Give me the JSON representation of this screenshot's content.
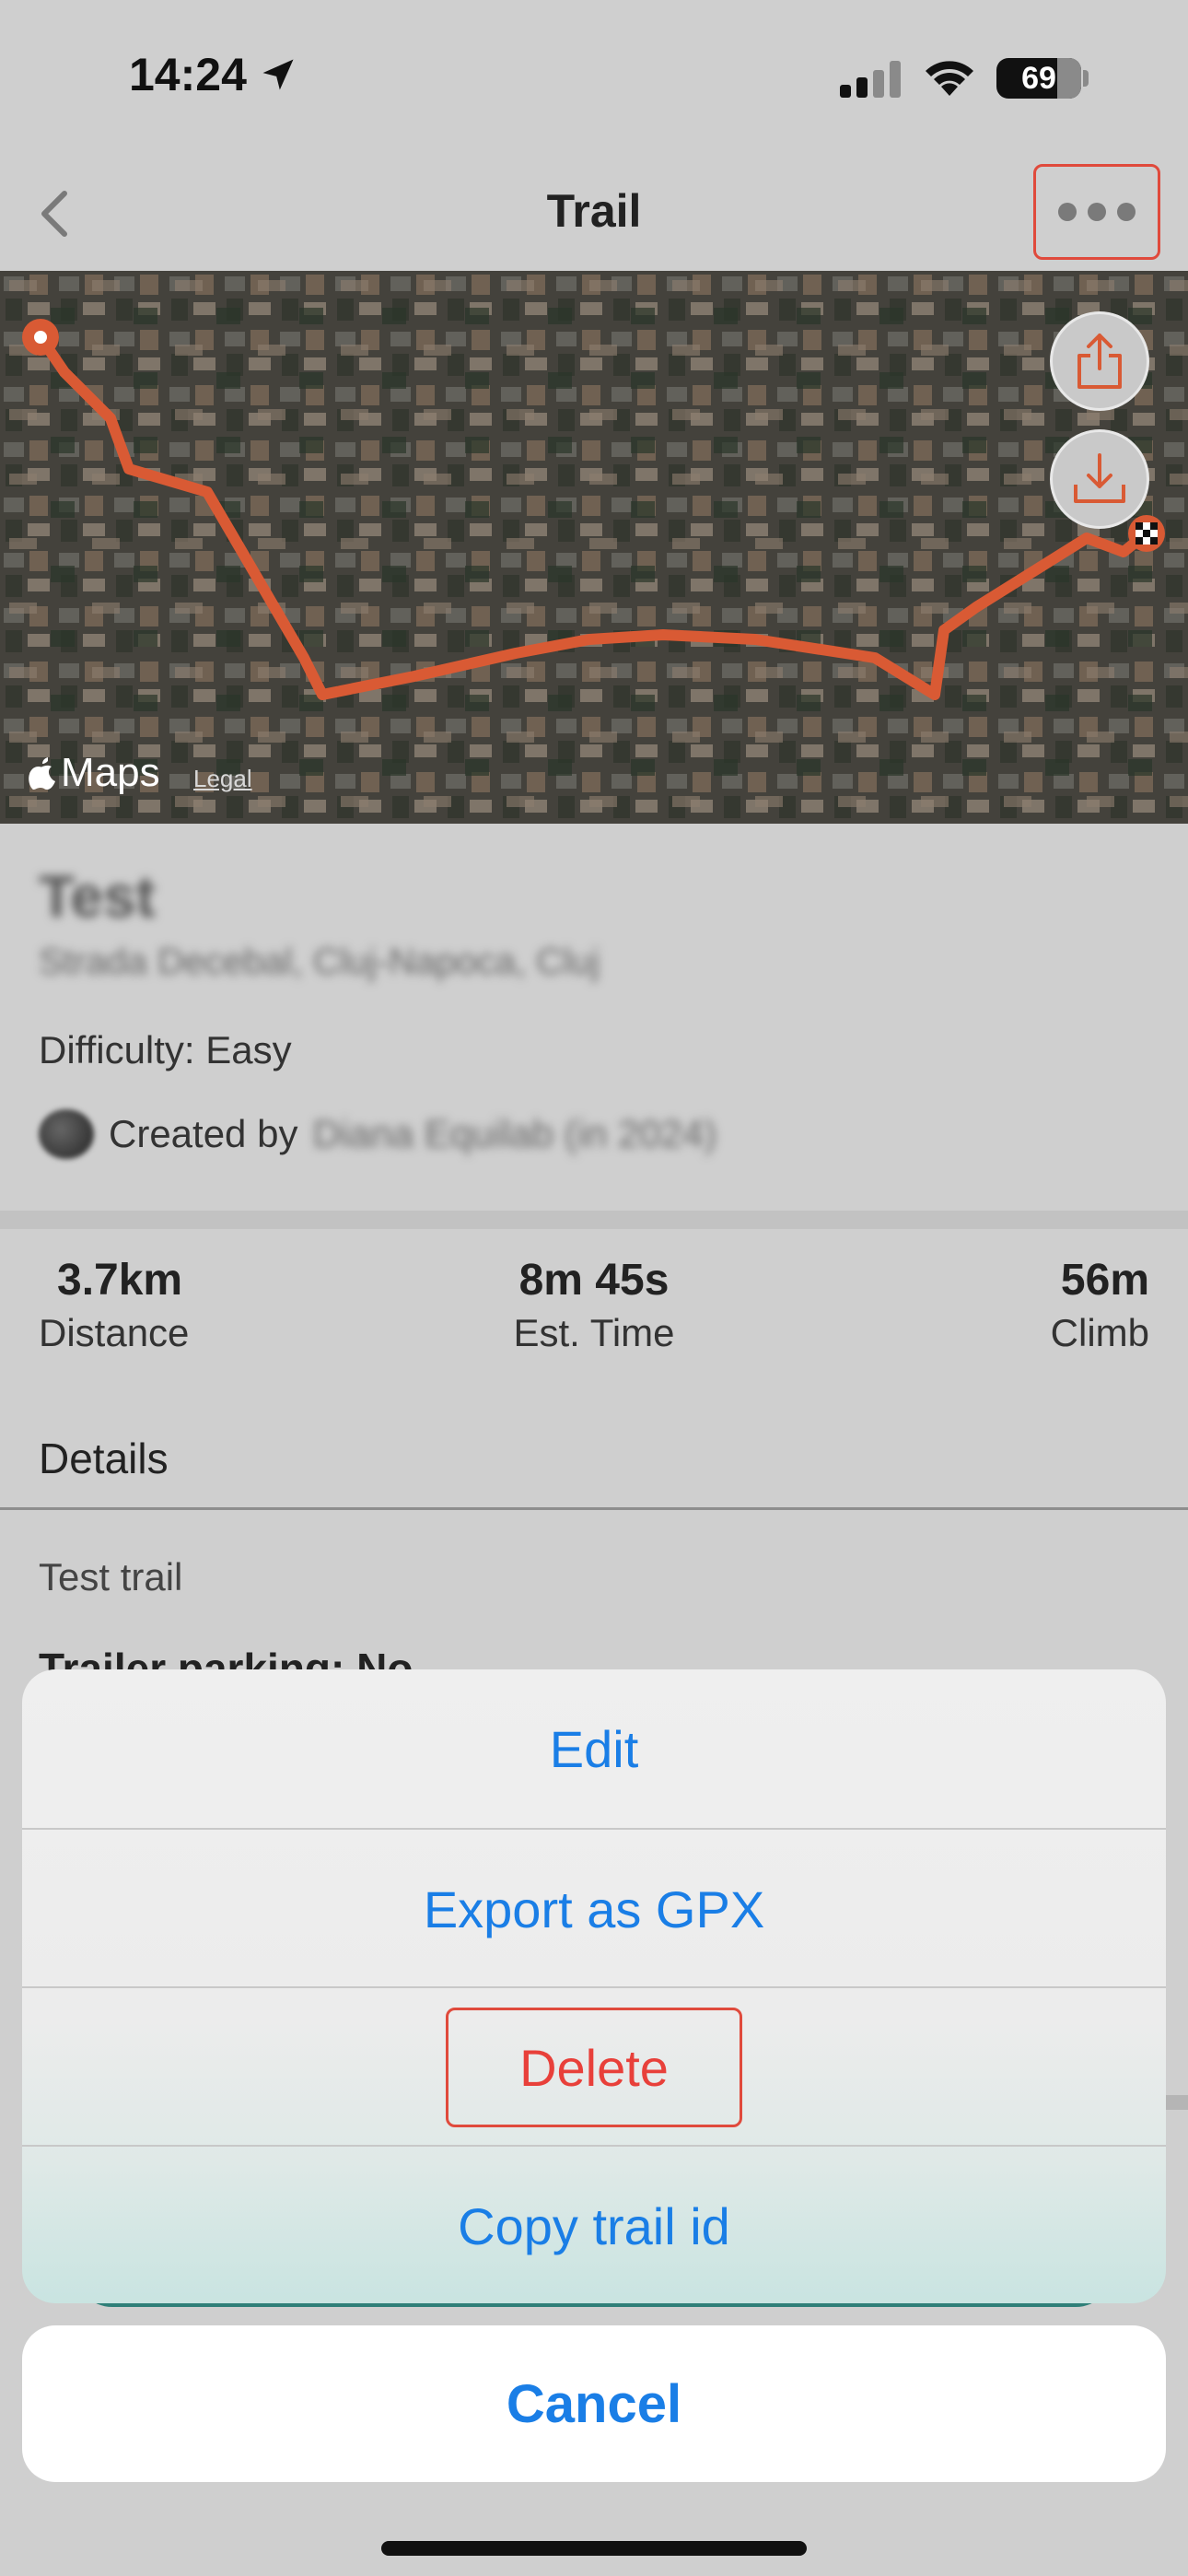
{
  "status_bar": {
    "time": "14:24",
    "battery": "69"
  },
  "nav": {
    "title": "Trail"
  },
  "map": {
    "attribution": "Maps",
    "legal": "Legal",
    "route_color": "#d95a34"
  },
  "trail": {
    "name": "Test",
    "address": "Strada Decebal, Cluj-Napoca, Cluj",
    "difficulty": "Difficulty: Easy",
    "created_by_label": "Created by",
    "creator": "Diana Equilab (in 2024)"
  },
  "stats": [
    {
      "value": "3.7km",
      "label": "Distance"
    },
    {
      "value": "8m 45s",
      "label": "Est. Time"
    },
    {
      "value": "56m",
      "label": "Climb"
    }
  ],
  "details": {
    "header": "Details",
    "description": "Test trail",
    "parking": "Trailer parking: No"
  },
  "action_sheet": {
    "items": [
      "Edit",
      "Export as GPX",
      "Delete",
      "Copy trail id"
    ],
    "cancel": "Cancel"
  },
  "colors": {
    "accent": "#1a7ee6",
    "destructive": "#e8403a",
    "highlight_border": "#e04a3c"
  }
}
